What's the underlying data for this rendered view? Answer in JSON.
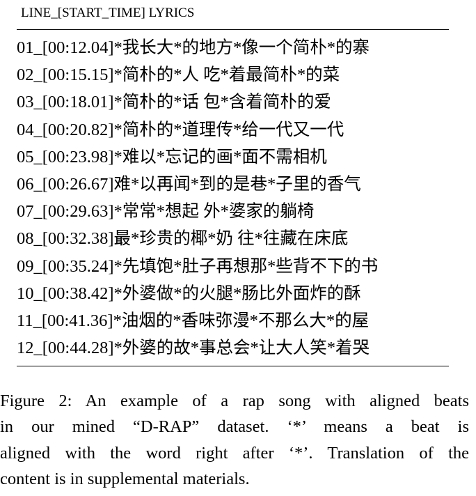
{
  "table": {
    "header": "LINE_[START_TIME] LYRICS",
    "rows": [
      "01_[00:12.04]*我长大*的地方*像一个简朴*的寨",
      "02_[00:15.15]*简朴的*人 吃*着最简朴*的菜",
      "03_[00:18.01]*简朴的*话 包*含着简朴的爱",
      "04_[00:20.82]*简朴的*道理传*给一代又一代",
      "05_[00:23.98]*难以*忘记的画*面不需相机",
      "06_[00:26.67]难*以再闻*到的是巷*子里的香气",
      "07_[00:29.63]*常常*想起 外*婆家的躺椅",
      "08_[00:32.38]最*珍贵的椰*奶 往*往藏在床底",
      "09_[00:35.24]*先填饱*肚子再想那*些背不下的书",
      "10_[00:38.42]*外婆做*的火腿*肠比外面炸的酥",
      "11_[00:41.36]*油烟的*香味弥漫*不那么大*的屋",
      "12_[00:44.28]*外婆的故*事总会*让大人笑*着哭"
    ]
  },
  "caption": {
    "lines": [
      "Figure 2: An example of a rap song with aligned beats",
      "in our mined “D-RAP” dataset. ‘*’ means a beat is",
      "aligned with the word right after ‘*’. Translation of the",
      "content is in supplemental materials."
    ]
  }
}
